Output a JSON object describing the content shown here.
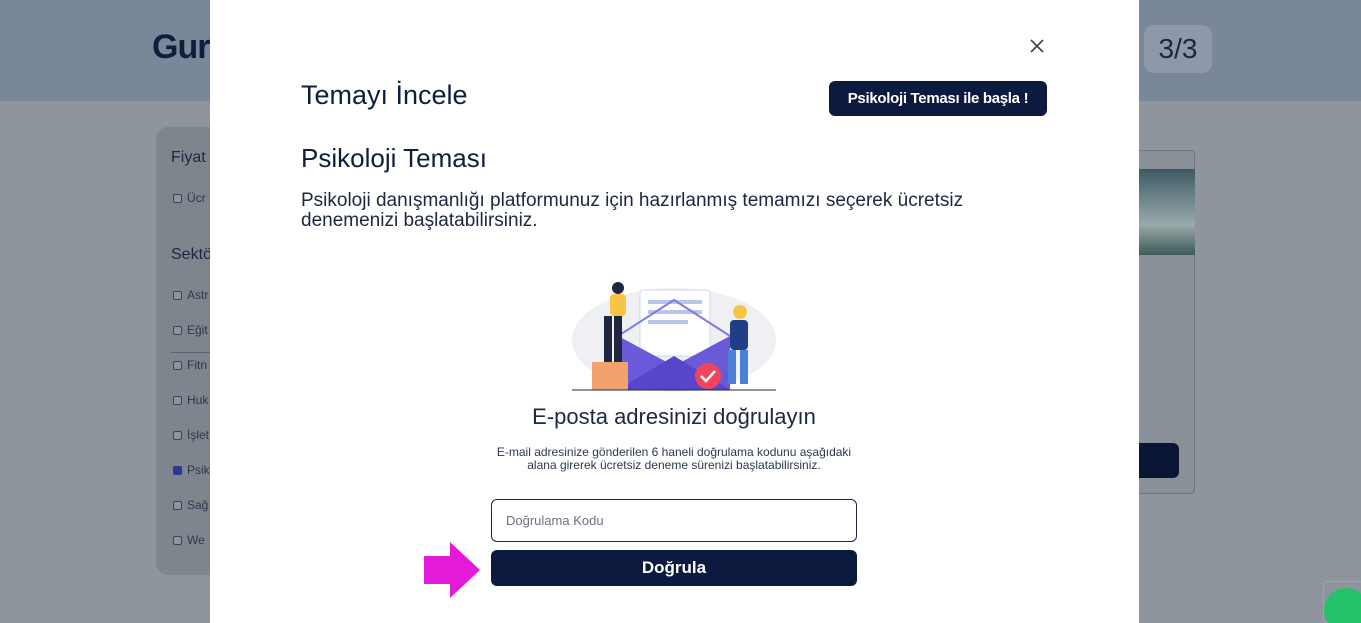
{
  "background": {
    "logo_text": "Gur",
    "step_indicator": "3/3",
    "sidebar": {
      "price_section": "Fiyat",
      "price_item": "Ücr",
      "sector_section": "Sektö",
      "sectors": [
        {
          "label": "Astr",
          "checked": false
        },
        {
          "label": "Eğit",
          "checked": false
        },
        {
          "label": "Fitn",
          "checked": false
        },
        {
          "label": "Huk",
          "checked": false
        },
        {
          "label": "İşlet",
          "checked": false
        },
        {
          "label": "Psik",
          "checked": true
        },
        {
          "label": "Sağ",
          "checked": false
        },
        {
          "label": "We",
          "checked": false
        }
      ]
    }
  },
  "modal": {
    "title": "Temayı İncele",
    "start_button": "Psikoloji Teması ile başla !",
    "theme_name": "Psikoloji Teması",
    "theme_description": "Psikoloji danışmanlığı platformunuz için hazırlanmış temamızı seçerek ücretsiz denemenizi başlatabilirsiniz.",
    "verify": {
      "title": "E-posta adresinizi doğrulayın",
      "description": "E-mail adresinize gönderilen 6 haneli doğrulama kodunu aşağıdaki alana girerek ücretsiz deneme sürenizi başlatabilirsiniz.",
      "code_placeholder": "Doğrulama Kodu",
      "code_value": "",
      "button_label": "Doğrula"
    }
  },
  "colors": {
    "primary": "#0c1a3f",
    "annotation_arrow": "#e31bd8",
    "overlay": "#8f959c"
  }
}
